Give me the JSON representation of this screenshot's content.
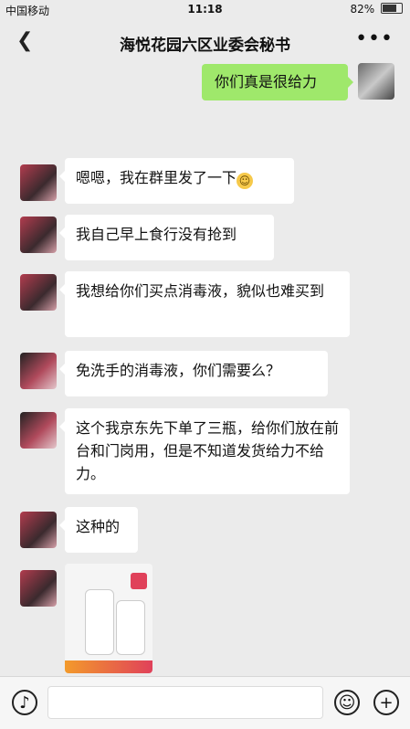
{
  "status_bar": {
    "carrier": "中国移动",
    "time": "11:18",
    "battery": "82%"
  },
  "header": {
    "back_icon": "chevron-left-icon",
    "title": "海悦花园六区业委会秘书",
    "more_icon": "ellipsis-icon"
  },
  "messages": [
    {
      "sender": "me",
      "text": "你们真是很给力"
    },
    {
      "sender": "other",
      "text": "嗯嗯，我在群里发了一下",
      "emoji": "grin-emoji"
    },
    {
      "sender": "other",
      "text": "我自己早上食行没有抢到"
    },
    {
      "sender": "other",
      "text": "我想给你们买点消毒液，貌似也难买到"
    },
    {
      "sender": "other",
      "text": "免洗手的消毒液，你们需要么？"
    },
    {
      "sender": "other",
      "text": "这个我京东先下单了三瓶，给你们放在前台和门岗用，但是不知道发货给力不给力。"
    },
    {
      "sender": "other",
      "text": "这种的"
    },
    {
      "sender": "other",
      "type": "image",
      "image_icon": "product-photo-icon"
    }
  ],
  "input_bar": {
    "voice_icon": "voice-icon",
    "emoji_icon": "smiley-icon",
    "plus_icon": "plus-icon",
    "input_value": ""
  }
}
